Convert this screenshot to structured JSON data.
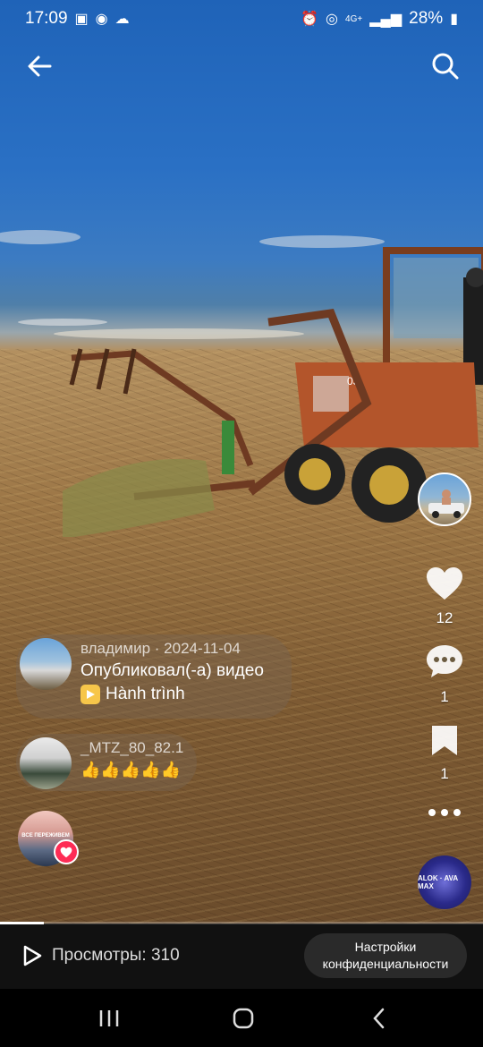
{
  "statusbar": {
    "time": "17:09",
    "battery": "28%",
    "network": "4G+"
  },
  "actions": {
    "likes": "12",
    "comments": "1",
    "saves": "1"
  },
  "comments": [
    {
      "name": "владимир · 2024-11-04",
      "text": "Опубликовал(-а) видео",
      "tag": "Hành trình"
    },
    {
      "name": "_MTZ_80_82.1",
      "text": "👍👍👍👍👍"
    }
  ],
  "third_avatar_caption": "ВСЕ ПЕРЕЖИВЕМ",
  "music_disc_label": "ALOK · AVA MAX",
  "progress_fraction": 0.09,
  "bottom": {
    "views": "Просмотры: 310",
    "privacy_button": "Настройки конфиденциальности"
  },
  "colors": {
    "like_heart": "#fe2c55",
    "tag_yellow": "#f7c64a"
  }
}
